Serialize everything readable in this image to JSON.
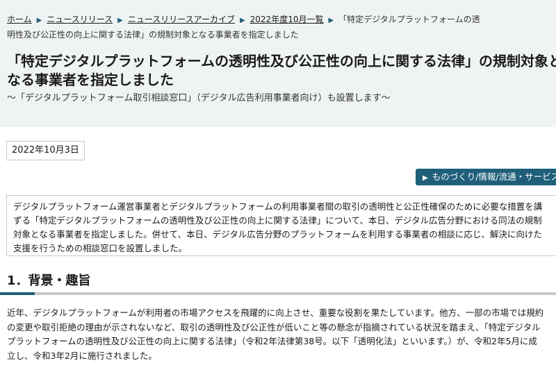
{
  "breadcrumb": {
    "items": [
      "ホーム",
      "ニュースリリース",
      "ニュースリリースアーカイブ",
      "2022年度10月一覧"
    ],
    "current_line1": "「特定デジタルプラットフォームの透",
    "current_line2": "明性及び公正性の向上に関する法律」の規制対象となる事業者を指定しました"
  },
  "title": {
    "line1": "「特定デジタルプラットフォームの透明性及び公正性の向上に関する法律」の規制対象と",
    "line2": "なる事業者を指定しました",
    "subtitle": "〜「デジタルプラットフォーム取引相談窓口」（デジタル広告利用事業者向け）も設置します〜"
  },
  "date": "2022年10月3日",
  "category_label": "ものづくり/情報/流通・サービス",
  "summary_lines": [
    "デジタルプラットフォーム運営事業者とデジタルプラットフォームの利用事業者間の取引の透明性と公正性確保のために必要な措置を講",
    "ずる「特定デジタルプラットフォームの透明性及び公正性の向上に関する法律」について、本日、デジタル広告分野における同法の規制",
    "対象となる事業者を指定しました。併せて、本日、デジタル広告分野のプラットフォームを利用する事業者の相談に応じ、解決に向けた",
    "支援を行うための相談窓口を設置しました。"
  ],
  "section": {
    "heading": "1．背景・趣旨",
    "lines": [
      "近年、デジタルプラットフォームが利用者の市場アクセスを飛躍的に向上させ、重要な役割を果たしています。他方、一部の市場では規約",
      "の変更や取引拒絶の理由が示されないなど、取引の透明性及び公正性が低いこと等の懸念が指摘されている状況を踏まえ、「特定デジタル",
      "プラットフォームの透明性及び公正性の向上に関する法律」（令和2年法律第38号。以下「透明化法」といいます。）が、令和2年5月に成",
      "立し、令和3年2月に施行されました。"
    ]
  },
  "colors": {
    "accent": "#1f5f7a",
    "header_bg": "#f0f3f3",
    "rule": "#c8c8c8"
  }
}
